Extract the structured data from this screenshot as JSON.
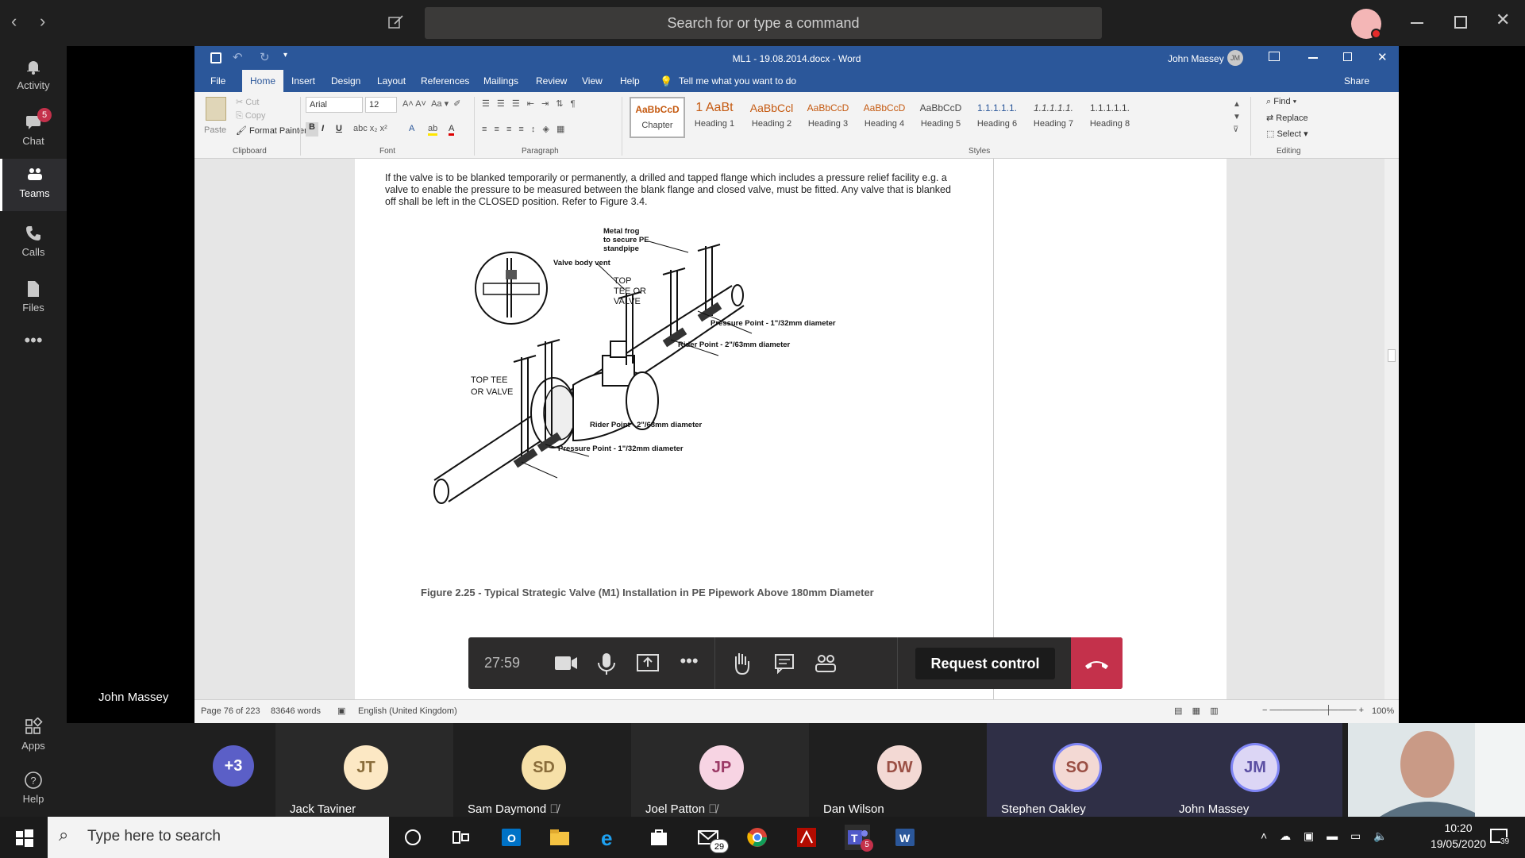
{
  "teams": {
    "search_placeholder": "Search for or type a command",
    "rail": [
      {
        "label": "Activity",
        "icon": "bell-icon"
      },
      {
        "label": "Chat",
        "icon": "chat-icon",
        "badge": "5"
      },
      {
        "label": "Teams",
        "icon": "teams-icon"
      },
      {
        "label": "Calls",
        "icon": "phone-icon"
      },
      {
        "label": "Files",
        "icon": "file-icon"
      },
      {
        "label": "Apps",
        "icon": "apps-icon"
      },
      {
        "label": "Help",
        "icon": "help-icon"
      }
    ],
    "presenter_name": "John Massey"
  },
  "word": {
    "title": "ML1 - 19.08.2014.docx  -  Word",
    "user": "John Massey",
    "user_initials": "JM",
    "tabs": [
      "File",
      "Home",
      "Insert",
      "Design",
      "Layout",
      "References",
      "Mailings",
      "Review",
      "View",
      "Help"
    ],
    "tell_me": "Tell me what you want to do",
    "share": "Share",
    "clipboard": {
      "paste": "Paste",
      "cut": "Cut",
      "copy": "Copy",
      "format_painter": "Format Painter",
      "label": "Clipboard"
    },
    "font": {
      "name": "Arial",
      "size": "12",
      "label": "Font"
    },
    "paragraph_label": "Paragraph",
    "styles": [
      {
        "preview": "AaBbCcD",
        "name": "Chapter"
      },
      {
        "preview": "1  AaBt",
        "name": "Heading 1"
      },
      {
        "preview": "AaBbCcl",
        "name": "Heading 2"
      },
      {
        "preview": "AaBbCcD",
        "name": "Heading 3"
      },
      {
        "preview": "AaBbCcD",
        "name": "Heading 4"
      },
      {
        "preview": "AaBbCcD",
        "name": "Heading 5"
      },
      {
        "preview": "1.1.1.1.1.",
        "name": "Heading 6"
      },
      {
        "preview": "1.1.1.1.1.",
        "name": "Heading 7"
      },
      {
        "preview": "1.1.1.1.1.",
        "name": "Heading 8"
      }
    ],
    "styles_label": "Styles",
    "editing": {
      "find": "Find",
      "replace": "Replace",
      "select": "Select",
      "label": "Editing"
    },
    "document": {
      "paragraph": "If the valve is to be blanked temporarily or permanently, a drilled and tapped flange which includes a pressure relief facility e.g. a valve to enable the pressure to be measured between the blank flange and closed valve, must be fitted. Any valve that is blanked off shall be left in the CLOSED position. Refer to Figure 3.4.",
      "diagram_labels": {
        "metal_frog": [
          "Metal frog",
          "to secure PE",
          "standpipe"
        ],
        "valve_body_vent": "Valve body vent",
        "top_tee_right": [
          "TOP",
          "TEE OR",
          "VALVE"
        ],
        "pressure_point_right": "Pressure Point - 1\"/32mm diameter",
        "rider_point_right": "Rider Point - 2\"/63mm diameter",
        "top_tee_left": [
          "TOP TEE",
          "OR VALVE"
        ],
        "rider_point_left": "Rider Point - 2\"/63mm diameter",
        "pressure_point_left": "Pressure Point - 1\"/32mm diameter"
      },
      "caption": "Figure 2.25 - Typical Strategic Valve (M1) Installation in PE Pipework Above 180mm Diameter"
    },
    "status": {
      "page": "Page 76 of 223",
      "words": "83646 words",
      "language": "English (United Kingdom)",
      "zoom": "100%"
    }
  },
  "call": {
    "timer": "27:59",
    "request_control": "Request control"
  },
  "participants": [
    {
      "initials": "+3",
      "name": "",
      "bg": "#5b5fc7",
      "fg": "#fff"
    },
    {
      "initials": "JT",
      "name": "Jack Taviner",
      "bg": "#fce8c4",
      "fg": "#8a6d3b"
    },
    {
      "initials": "SD",
      "name": "Sam Daymond",
      "bg": "#f6e0a8",
      "fg": "#8a6d3b",
      "muted": true
    },
    {
      "initials": "JP",
      "name": "Joel Patton",
      "bg": "#f7d4e3",
      "fg": "#9b3a66",
      "muted": true
    },
    {
      "initials": "DW",
      "name": "Dan Wilson",
      "bg": "#f3d9d4",
      "fg": "#9a4f44"
    },
    {
      "initials": "SO",
      "name": "Stephen Oakley",
      "bg": "#f3d9d4",
      "fg": "#9a4f44"
    },
    {
      "initials": "JM",
      "name": "John Massey",
      "bg": "#dcd6f5",
      "fg": "#5b4fa3"
    }
  ],
  "taskbar": {
    "search_placeholder": "Type here to search",
    "time": "10:20",
    "date": "19/05/2020",
    "notifications": "39",
    "mail_badge": "29",
    "teams_badge": "5"
  }
}
